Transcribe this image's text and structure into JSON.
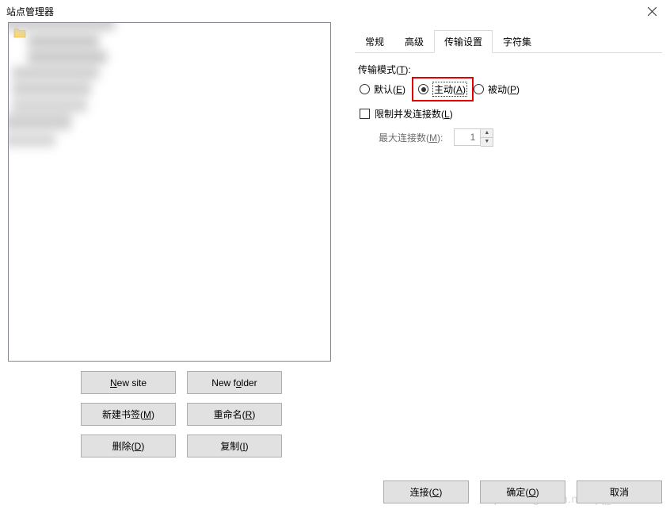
{
  "title": "站点管理器",
  "tree": {
    "folder_icon": "folder"
  },
  "buttons": {
    "new_site_pre": "N",
    "new_site_post": "ew site",
    "new_folder_pre": "New f",
    "new_folder_u": "o",
    "new_folder_post": "lder",
    "new_bookmark": "新建书签(",
    "new_bookmark_u": "M",
    "new_bookmark_post": ")",
    "rename": "重命名(",
    "rename_u": "R",
    "rename_post": ")",
    "delete": "删除(",
    "delete_u": "D",
    "delete_post": ")",
    "copy": "复制(",
    "copy_u": "I",
    "copy_post": ")"
  },
  "tabs": [
    {
      "label": "常规",
      "active": false
    },
    {
      "label": "高级",
      "active": false
    },
    {
      "label": "传输设置",
      "active": true
    },
    {
      "label": "字符集",
      "active": false
    }
  ],
  "transfer": {
    "mode_label": "传输模式(",
    "mode_label_u": "T",
    "mode_label_post": "):",
    "radio_default": "默认(",
    "radio_default_u": "E",
    "radio_default_post": ")",
    "radio_active": "主动(",
    "radio_active_u": "A",
    "radio_active_post": ")",
    "radio_passive": "被动(",
    "radio_passive_u": "P",
    "radio_passive_post": ")",
    "limit_label": "限制并发连接数(",
    "limit_label_u": "L",
    "limit_label_post": ")",
    "max_conn_label": "最大连接数(",
    "max_conn_label_u": "M",
    "max_conn_label_post": "):",
    "max_conn_value": "1"
  },
  "bottom": {
    "connect": "连接(",
    "connect_u": "C",
    "connect_post": ")",
    "ok": "确定(",
    "ok_u": "O",
    "ok_post": ")",
    "cancel": "取消"
  },
  "watermark": "https://blog.csdn.net/qq_41534621"
}
